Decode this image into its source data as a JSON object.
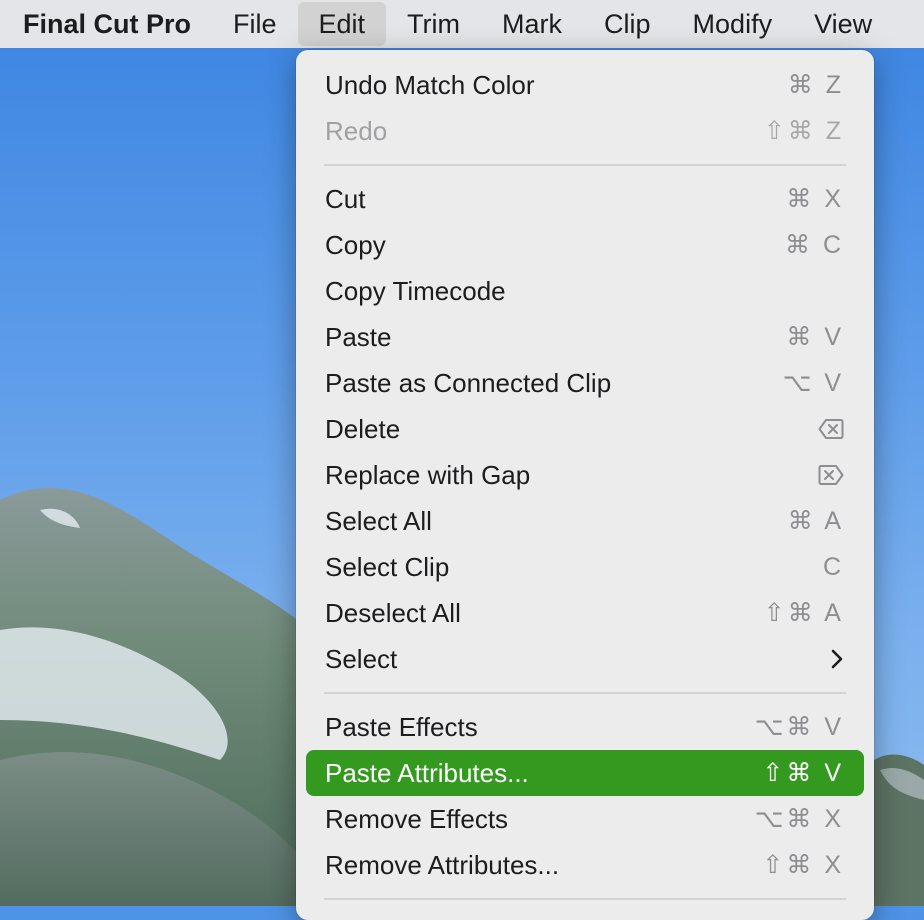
{
  "menubar": {
    "app_name": "Final Cut Pro",
    "items": [
      "File",
      "Edit",
      "Trim",
      "Mark",
      "Clip",
      "Modify",
      "View"
    ],
    "active_item": "Edit"
  },
  "menu": {
    "groups": [
      [
        {
          "label": "Undo Match Color",
          "shortcut": "⌘ Z",
          "disabled": false
        },
        {
          "label": "Redo",
          "shortcut": "⇧⌘ Z",
          "disabled": true
        }
      ],
      [
        {
          "label": "Cut",
          "shortcut": "⌘ X"
        },
        {
          "label": "Copy",
          "shortcut": "⌘ C"
        },
        {
          "label": "Copy Timecode",
          "shortcut": ""
        },
        {
          "label": "Paste",
          "shortcut": "⌘ V"
        },
        {
          "label": "Paste as Connected Clip",
          "shortcut": "⌥ V"
        },
        {
          "label": "Delete",
          "shortcut_icon": "delete-backward-icon"
        },
        {
          "label": "Replace with Gap",
          "shortcut_icon": "delete-forward-icon"
        },
        {
          "label": "Select All",
          "shortcut": "⌘ A"
        },
        {
          "label": "Select Clip",
          "shortcut": "C"
        },
        {
          "label": "Deselect All",
          "shortcut": "⇧⌘ A"
        },
        {
          "label": "Select",
          "shortcut_icon": "chevron-right-icon"
        }
      ],
      [
        {
          "label": "Paste Effects",
          "shortcut": "⌥⌘ V"
        },
        {
          "label": "Paste Attributes...",
          "shortcut": "⇧⌘ V",
          "highlighted": true
        },
        {
          "label": "Remove Effects",
          "shortcut": "⌥⌘ X"
        },
        {
          "label": "Remove Attributes...",
          "shortcut": "⇧⌘ X"
        }
      ]
    ]
  },
  "colors": {
    "highlight": "#33991f",
    "menu_background": "#ececec",
    "menubar_background": "#e8e8e8"
  }
}
